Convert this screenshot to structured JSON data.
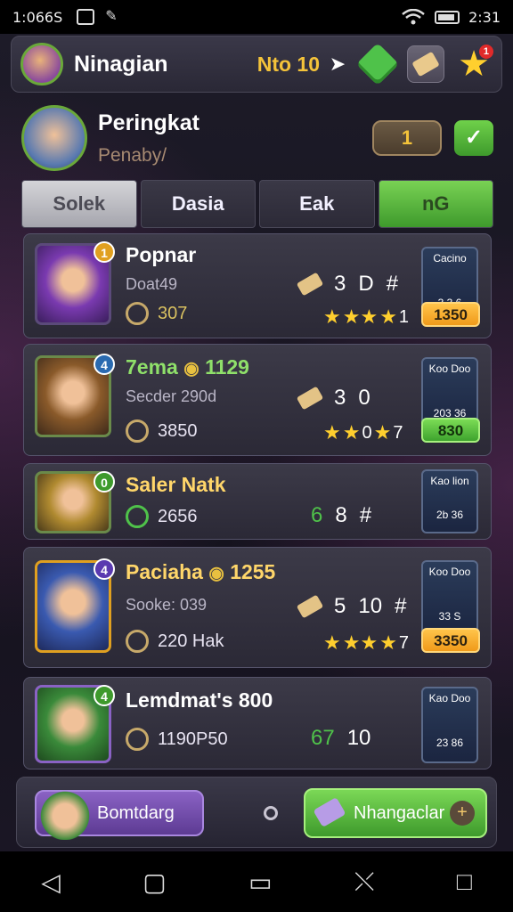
{
  "statusbar": {
    "time": "1:066S",
    "clock": "2:31"
  },
  "header": {
    "title": "Ninagian",
    "level": "Nto 10",
    "star_badge": "1"
  },
  "profile": {
    "title": "Peringkat",
    "subtitle": "Penaby/",
    "rank": "1",
    "confirm": "✓"
  },
  "tabs": [
    {
      "label": "Solek"
    },
    {
      "label": "Dasia"
    },
    {
      "label": "Eak"
    },
    {
      "label": "nG"
    }
  ],
  "players": [
    {
      "rank": "1",
      "name": "Popnar",
      "sub": "Doat49",
      "score": "307",
      "stat_a": "3",
      "stat_b": "D",
      "stat_c": "#",
      "stars_num": "1",
      "card_title": "Cacino",
      "card_val": "3 3 6",
      "pill": "1350",
      "pill_color": "orange"
    },
    {
      "rank": "4",
      "name": "7ema",
      "name_extra": "1129",
      "sub": "Secder 290d",
      "score": "3850",
      "stat_a": "3",
      "stat_b": "0",
      "stat_c": "",
      "stars_num": "7",
      "card_title": "Koo Doo",
      "card_val": "203 36",
      "pill": "830",
      "pill_color": "green"
    },
    {
      "rank": "0",
      "name": "Saler Natk",
      "sub": "",
      "score": "2656",
      "stat_a": "6",
      "stat_b": "8",
      "stat_c": "#",
      "stars_num": "",
      "card_title": "Kao lion",
      "card_val": "2b 36",
      "pill": "",
      "pill_color": ""
    },
    {
      "rank": "4",
      "name": "Paciaha",
      "name_extra": "1255",
      "sub": "Sooke: 039",
      "score": "220 Hak",
      "stat_a": "5",
      "stat_b": "10",
      "stat_c": "#",
      "stars_num": "7",
      "card_title": "Koo Doo",
      "card_val": "33 S",
      "pill": "3350",
      "pill_color": "orange"
    },
    {
      "rank": "4",
      "name": "Lemdmat's 800",
      "sub": "",
      "score": "1190P50",
      "stat_a": "67",
      "stat_b": "10",
      "stat_c": "",
      "stars_num": "",
      "card_title": "Kao Doo",
      "card_val": "23 86",
      "pill": "",
      "pill_color": ""
    }
  ],
  "actions": {
    "left_label": "Bomtdarg",
    "right_label": "Nhangaclar"
  },
  "colors": {
    "accent_green": "#4fc24a",
    "accent_gold": "#f4c33a",
    "accent_purple": "#8a62c4"
  }
}
